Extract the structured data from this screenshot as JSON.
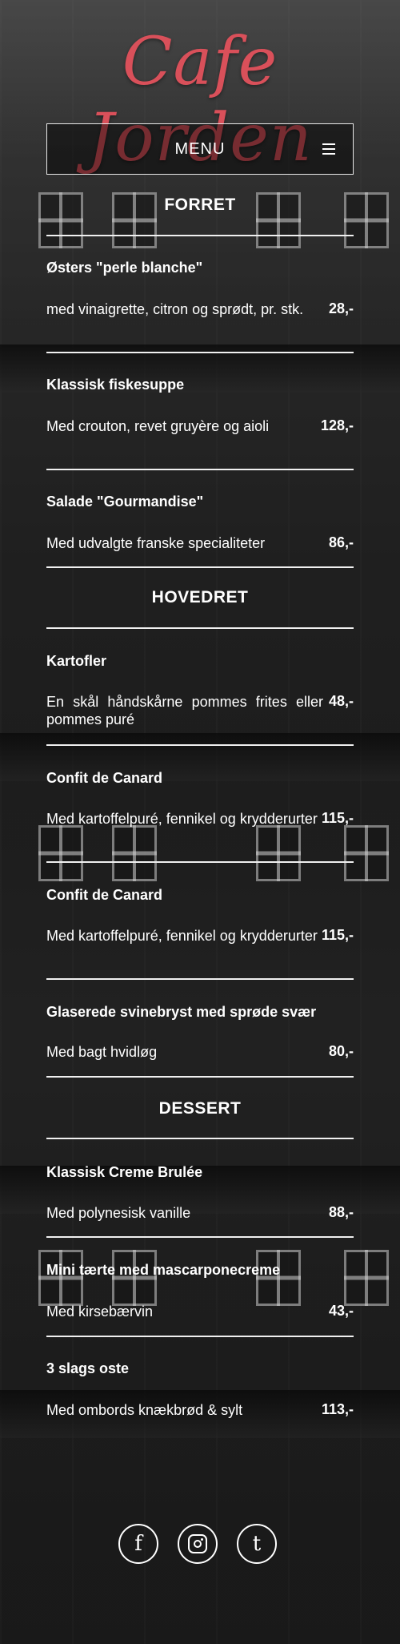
{
  "brand": {
    "logo_text": "Cafe Jorden",
    "accent_color": "#d9505a"
  },
  "nav": {
    "menu_label": "MENU",
    "menu_icon": "hamburger-icon"
  },
  "sections": [
    {
      "title": "FORRET",
      "items": [
        {
          "name": "Østers \"perle blanche\"",
          "description": "med vinaigrette, citron og sprødt, pr. stk.",
          "price": "28,-"
        },
        {
          "name": "Klassisk fiskesuppe",
          "description": "Med crouton, revet gruyère og aioli",
          "price": "128,-"
        },
        {
          "name": "Salade \"Gourmandise\"",
          "description": "Med udvalgte franske specialiteter",
          "price": "86,-"
        }
      ]
    },
    {
      "title": "HOVEDRET",
      "items": [
        {
          "name": "Kartofler",
          "description": "En skål håndskårne pommes frites eller pommes puré",
          "price": "48,-"
        },
        {
          "name": "Confit de Canard",
          "description": "Med kartoffelpuré, fennikel og krydderurter",
          "price": "115,-"
        },
        {
          "name": "Confit de Canard",
          "description": "Med kartoffelpuré, fennikel og krydderurter",
          "price": "115,-"
        },
        {
          "name": "Glaserede svinebryst med sprøde svær",
          "description": "Med bagt hvidløg",
          "price": "80,-"
        }
      ]
    },
    {
      "title": "DESSERT",
      "items": [
        {
          "name": "Klassisk Creme Brulée",
          "description": "Med polynesisk vanille",
          "price": "88,-"
        },
        {
          "name": "Mini tærte med mascarponecreme",
          "description": "Med kirsebærvin",
          "price": "43,-"
        },
        {
          "name": "3 slags oste",
          "description": "Med ombords knækbrød & sylt",
          "price": "113,-"
        }
      ]
    }
  ],
  "social": [
    {
      "icon": "facebook-icon",
      "glyph": "f"
    },
    {
      "icon": "instagram-icon"
    },
    {
      "icon": "tumblr-icon",
      "glyph": "t"
    }
  ]
}
